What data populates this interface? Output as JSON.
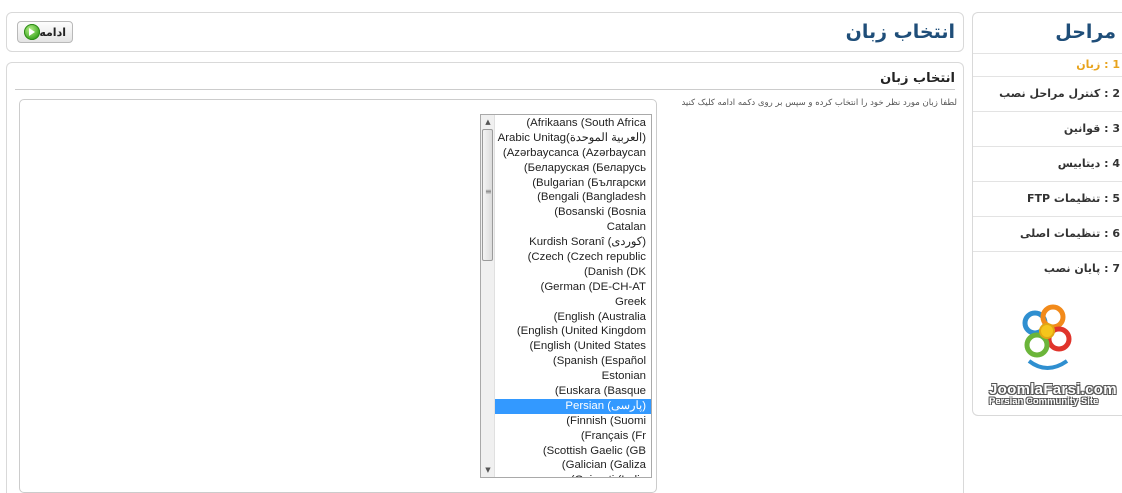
{
  "header": {
    "title": "انتخاب زبان",
    "continue_label": "ادامه"
  },
  "main": {
    "heading": "انتخاب زبان",
    "instructions": "لطفا زبان مورد نظر خود را انتخاب کرده و سپس بر روی دکمه ادامه کلیک کنید",
    "selected_language": "Persian (پارسی)",
    "languages": [
      "(Afrikaans (South Africa",
      "Arabic Unitag(العربية الموحدة)",
      "(Azərbaycanca (Azərbaycan",
      "(Беларуская (Беларусь",
      "(Bulgarian (Български",
      "(Bengali (Bangladesh",
      "(Bosanski (Bosnia",
      "Catalan",
      "Kurdish Soranî (کوردی)",
      "(Czech (Czech republic",
      "(Danish (DK",
      "(German (DE-CH-AT",
      "Greek",
      "(English (Australia",
      "(English (United Kingdom",
      "(English (United States",
      "(Spanish (Español",
      "Estonian",
      "(Euskara (Basque",
      "Persian (پارسی)",
      "(Finnish (Suomi",
      "(Français (Fr",
      "(Scottish Gaelic (GB",
      "(Galician (Galiza",
      "(Gujarati (India"
    ]
  },
  "sidebar": {
    "title": "مراحل",
    "steps": [
      "1 : زبان",
      "2 : کنترل مراحل نصب",
      "3 : قوانین",
      "4 : دیتابیس",
      "5 : تنظیمات FTP",
      "6 : تنظیمات اصلی",
      "7 : پایان نصب"
    ],
    "active_step": 0,
    "logo_name": "JoomlaFarsi.com",
    "logo_sub": "Persian Community Site"
  },
  "colors": {
    "title_blue": "#1f4e79",
    "active_step": "#e8a31c",
    "selection": "#3399ff"
  }
}
